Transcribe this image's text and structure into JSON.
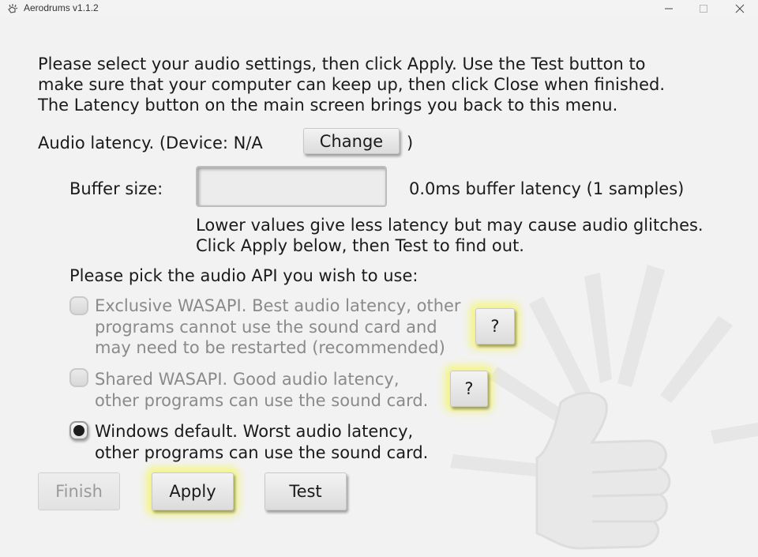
{
  "window": {
    "title": "Aerodrums v1.1.2",
    "icons": [
      "app-icon",
      "minimize-icon",
      "maximize-icon",
      "close-icon"
    ]
  },
  "intro": {
    "lines": [
      "Please select your audio settings, then click Apply. Use the Test button to",
      "make sure that your computer can keep up, then click Close when finished.",
      "The Latency button on the main screen brings you back to this menu."
    ]
  },
  "latency": {
    "label": "Audio latency.  (Device: N/A",
    "change_label": "Change",
    "close_paren": ")"
  },
  "buffer": {
    "label": "Buffer size:",
    "value": "",
    "info": "0.0ms buffer latency (1 samples)",
    "hint_lines": [
      "Lower values give less latency but may cause audio glitches.",
      "Click Apply below, then Test to find out."
    ]
  },
  "api": {
    "title": "Please pick the audio API you wish to use:",
    "options": [
      {
        "lines": [
          "Exclusive WASAPI. Best audio latency, other",
          "programs cannot use the sound card and",
          "may need to be restarted (recommended)"
        ],
        "selected": false,
        "enabled": false,
        "help_label": "?"
      },
      {
        "lines": [
          "Shared WASAPI. Good audio latency,",
          "other programs can use the sound card."
        ],
        "selected": false,
        "enabled": false,
        "help_label": "?"
      },
      {
        "lines": [
          "Windows default. Worst audio latency,",
          "other programs can use the sound card."
        ],
        "selected": true,
        "enabled": true
      }
    ]
  },
  "footer": {
    "finish_label": "Finish",
    "apply_label": "Apply",
    "test_label": "Test"
  },
  "colors": {
    "background": "#f2f2f2",
    "text": "#1a1a1a",
    "disabled_text": "#8a8a8a",
    "glow": "#f6f65a"
  }
}
